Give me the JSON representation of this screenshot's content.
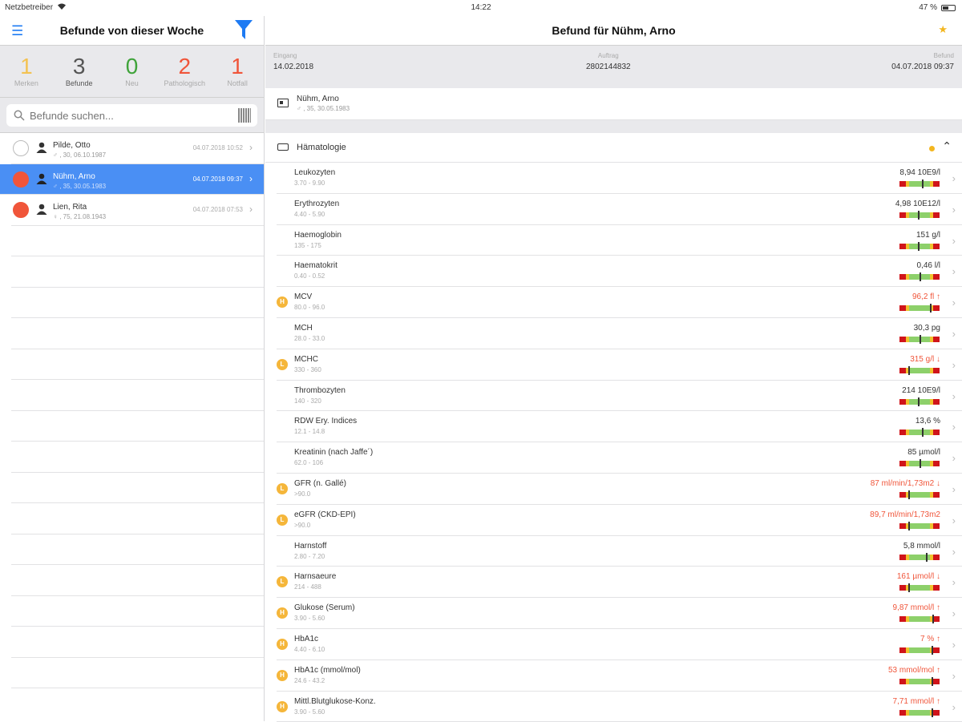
{
  "status": {
    "carrier": "Netzbetreiber",
    "time": "14:22",
    "battery": "47 %"
  },
  "left": {
    "title": "Befunde von dieser Woche",
    "counts": [
      {
        "num": "1",
        "label": "Merken",
        "color": "#f3c252"
      },
      {
        "num": "3",
        "label": "Befunde",
        "color": "#555555"
      },
      {
        "num": "0",
        "label": "Neu",
        "color": "#3fa33a"
      },
      {
        "num": "2",
        "label": "Pathologisch",
        "color": "#f0553a"
      },
      {
        "num": "1",
        "label": "Notfall",
        "color": "#f0553a"
      }
    ],
    "search_placeholder": "Befunde suchen...",
    "patients": [
      {
        "name": "Pilde, Otto",
        "sub": "♂ , 30, 06.10.1987",
        "date": "04.07.2018 10:52",
        "dot": "none",
        "selected": false
      },
      {
        "name": "Nühm, Arno",
        "sub": "♂ , 35, 30.05.1983",
        "date": "04.07.2018 09:37",
        "dot": "red",
        "selected": true
      },
      {
        "name": "Lien, Rita",
        "sub": "♀ , 75, 21.08.1943",
        "date": "04.07.2018 07:53",
        "dot": "red",
        "selected": false
      }
    ]
  },
  "right": {
    "title": "Befund für Nühm, Arno",
    "info": {
      "eingang_label": "Eingang",
      "eingang_value": "14.02.2018",
      "auftrag_label": "Auftrag",
      "auftrag_value": "2802144832",
      "befund_label": "Befund",
      "befund_value": "04.07.2018 09:37"
    },
    "patient": {
      "name": "Nühm, Arno",
      "sub": "♂ , 35, 30.05.1983"
    },
    "section": "Hämatologie",
    "rows": [
      {
        "name": "Leukozyten",
        "ref": "3.70 - 9.90",
        "value": "8,94 10E9/l",
        "abn": false,
        "flag": "",
        "marker": 0.55
      },
      {
        "name": "Erythrozyten",
        "ref": "4.40 - 5.90",
        "value": "4,98 10E12/l",
        "abn": false,
        "flag": "",
        "marker": 0.45
      },
      {
        "name": "Haemoglobin",
        "ref": "135 - 175",
        "value": "151 g/l",
        "abn": false,
        "flag": "",
        "marker": 0.45
      },
      {
        "name": "Haematokrit",
        "ref": "0.40 - 0.52",
        "value": "0,46 l/l",
        "abn": false,
        "flag": "",
        "marker": 0.5
      },
      {
        "name": "MCV",
        "ref": "80.0 - 96.0",
        "value": "96,2 fl ↑",
        "abn": true,
        "flag": "H",
        "marker": 0.76
      },
      {
        "name": "MCH",
        "ref": "28.0 - 33.0",
        "value": "30,3 pg",
        "abn": false,
        "flag": "",
        "marker": 0.5
      },
      {
        "name": "MCHC",
        "ref": "330 - 360",
        "value": "315 g/l ↓",
        "abn": true,
        "flag": "L",
        "marker": 0.22
      },
      {
        "name": "Thrombozyten",
        "ref": "140 - 320",
        "value": "214 10E9/l",
        "abn": false,
        "flag": "",
        "marker": 0.45
      },
      {
        "name": "RDW Ery. Indices",
        "ref": "12.1 - 14.8",
        "value": "13,6 %",
        "abn": false,
        "flag": "",
        "marker": 0.55
      },
      {
        "name": "Kreatinin (nach Jaffe´)",
        "ref": "62.0 - 106",
        "value": "85 µmol/l",
        "abn": false,
        "flag": "",
        "marker": 0.5
      },
      {
        "name": "GFR (n. Gallé)",
        "ref": ">90.0",
        "value": "87 ml/min/1,73m2 ↓",
        "abn": true,
        "flag": "L",
        "marker": 0.22
      },
      {
        "name": "eGFR (CKD-EPI)",
        "ref": ">90.0",
        "value": "89,7 ml/min/1,73m2",
        "abn": true,
        "flag": "L",
        "marker": 0.22
      },
      {
        "name": "Harnstoff",
        "ref": "2.80 - 7.20",
        "value": "5,8 mmol/l",
        "abn": false,
        "flag": "",
        "marker": 0.65
      },
      {
        "name": "Harnsaeure",
        "ref": "214 - 488",
        "value": "161 µmol/l ↓",
        "abn": true,
        "flag": "L",
        "marker": 0.22
      },
      {
        "name": "Glukose (Serum)",
        "ref": "3.90 - 5.60",
        "value": "9,87 mmol/l ↑",
        "abn": true,
        "flag": "H",
        "marker": 0.82
      },
      {
        "name": "HbA1c",
        "ref": "4.40 - 6.10",
        "value": "7 % ↑",
        "abn": true,
        "flag": "H",
        "marker": 0.8
      },
      {
        "name": "HbA1c (mmol/mol)",
        "ref": "24.6 - 43.2",
        "value": "53 mmol/mol ↑",
        "abn": true,
        "flag": "H",
        "marker": 0.8
      },
      {
        "name": "Mittl.Blutglukose-Konz.",
        "ref": "3.90 - 5.60",
        "value": "7,71 mmol/l ↑",
        "abn": true,
        "flag": "H",
        "marker": 0.8
      }
    ]
  }
}
